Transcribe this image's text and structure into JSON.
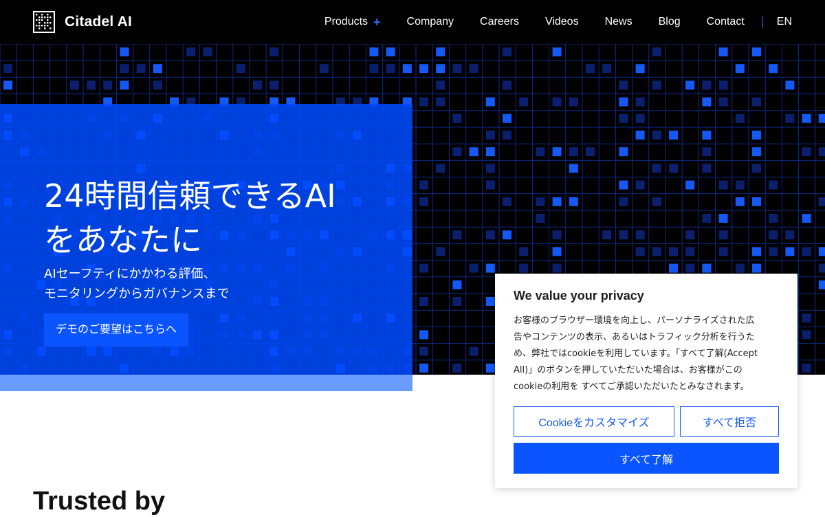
{
  "brand": {
    "name": "Citadel AI",
    "logo_icon": "grid-logo-icon"
  },
  "nav": {
    "items": [
      {
        "label": "Products",
        "has_plus": true
      },
      {
        "label": "Company"
      },
      {
        "label": "Careers"
      },
      {
        "label": "Videos"
      },
      {
        "label": "News"
      },
      {
        "label": "Blog"
      },
      {
        "label": "Contact"
      }
    ],
    "plus_symbol": "+",
    "language": "EN"
  },
  "hero": {
    "title_lines": [
      "24時間信頼できるAI",
      "をあなたに"
    ],
    "subtitle_lines": [
      "AIセーフティにかかわる評価、",
      "モニタリングからガバナンスまで"
    ],
    "cta_label": "デモのご要望はこちらへ"
  },
  "trusted": {
    "heading": "Trusted by"
  },
  "cookie": {
    "title": "We value your privacy",
    "body_lines": [
      "お客様のブラウザー環境を向上し、パーソナライズされた広",
      "告やコンテンツの表示、あるいはトラフィック分析を行うた",
      "め、弊社ではcookieを利用しています。「すべて了解(Accept",
      "All)」のボタンを押していただいた場合は、お客様がこの",
      "cookieの利用を すべてご承認いただいたとみなされます。"
    ],
    "customize_label": "Cookieをカスタマイズ",
    "reject_label": "すべて拒否",
    "accept_label": "すべて了解"
  },
  "colors": {
    "header_bg": "#000000",
    "accent_blue": "#0a55ff",
    "grid_line": "#0c2a8a",
    "grid_bright": "#1458f5",
    "grid_dim": "#0a1f6e",
    "panel_blue": "#004aff",
    "panel_strip": "#6a9bff"
  }
}
